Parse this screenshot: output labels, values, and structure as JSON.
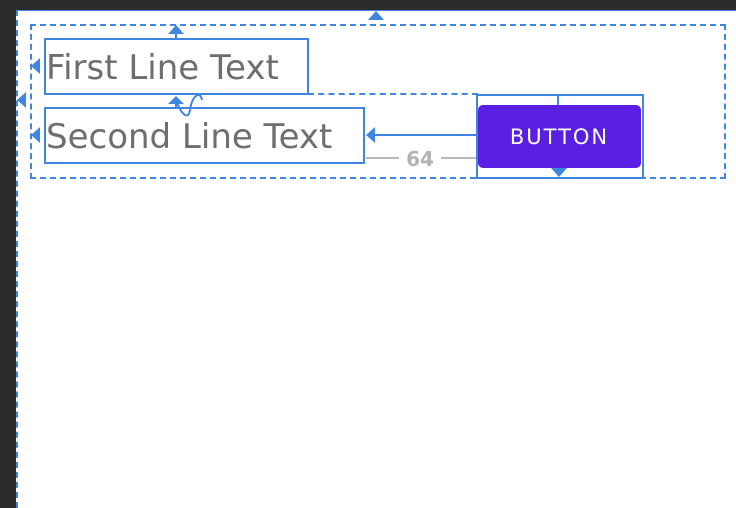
{
  "layout_editor": {
    "first_text": "First Line Text",
    "second_text": "Second Line Text",
    "button_label": "BUTTON",
    "margin_label": "64"
  },
  "colors": {
    "selection": "#3f86e0",
    "button": "#5b1fe3",
    "text": "#6e6e6e",
    "background": "#2b2b2b"
  }
}
